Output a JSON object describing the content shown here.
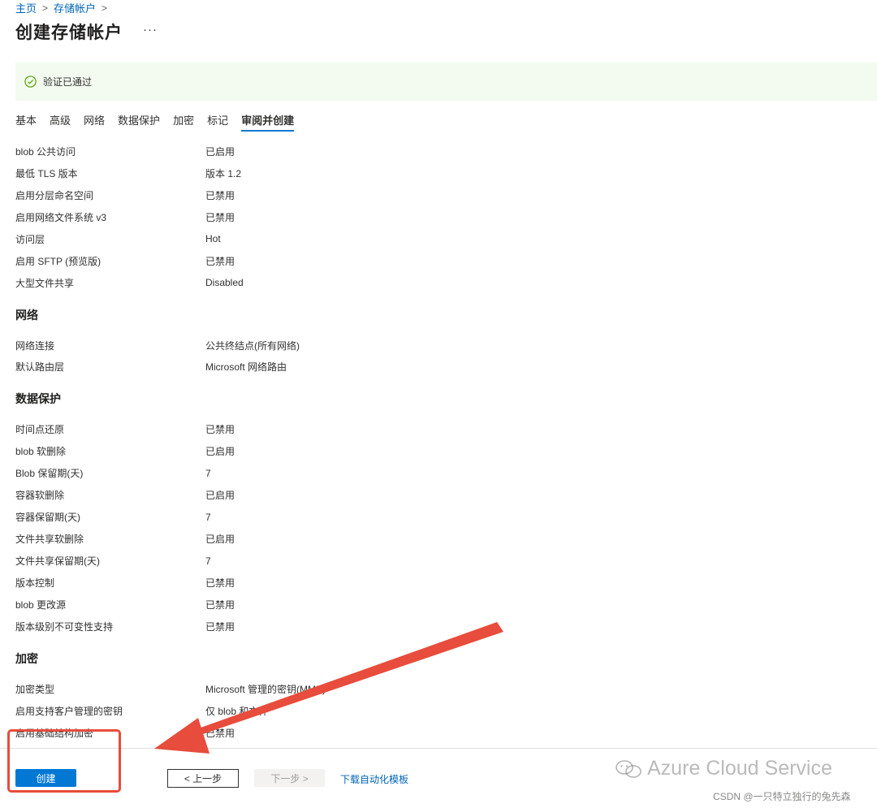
{
  "breadcrumb": {
    "home": "主页",
    "storage": "存储帐户",
    "sep": ">"
  },
  "page": {
    "title": "创建存储帐户",
    "more": "···"
  },
  "banner": {
    "message": "验证已通过"
  },
  "tabs": [
    {
      "label": "基本",
      "active": false
    },
    {
      "label": "高级",
      "active": false
    },
    {
      "label": "网络",
      "active": false
    },
    {
      "label": "数据保护",
      "active": false
    },
    {
      "label": "加密",
      "active": false
    },
    {
      "label": "标记",
      "active": false
    },
    {
      "label": "审阅并创建",
      "active": true
    }
  ],
  "advanced_rows": [
    {
      "key": "blob 公共访问",
      "value": "已启用"
    },
    {
      "key": "最低 TLS 版本",
      "value": "版本 1.2"
    },
    {
      "key": "启用分层命名空间",
      "value": "已禁用"
    },
    {
      "key": "启用网络文件系统 v3",
      "value": "已禁用"
    },
    {
      "key": "访问层",
      "value": "Hot"
    },
    {
      "key": "启用 SFTP (预览版)",
      "value": "已禁用"
    },
    {
      "key": "大型文件共享",
      "value": "Disabled"
    }
  ],
  "network": {
    "heading": "网络",
    "rows": [
      {
        "key": "网络连接",
        "value": "公共终结点(所有网络)"
      },
      {
        "key": "默认路由层",
        "value": "Microsoft 网络路由"
      }
    ]
  },
  "data_protection": {
    "heading": "数据保护",
    "rows": [
      {
        "key": "时间点还原",
        "value": "已禁用"
      },
      {
        "key": "blob 软删除",
        "value": "已启用"
      },
      {
        "key": "Blob 保留期(天)",
        "value": "7"
      },
      {
        "key": "容器软删除",
        "value": "已启用"
      },
      {
        "key": "容器保留期(天)",
        "value": "7"
      },
      {
        "key": "文件共享软删除",
        "value": "已启用"
      },
      {
        "key": "文件共享保留期(天)",
        "value": "7"
      },
      {
        "key": "版本控制",
        "value": "已禁用"
      },
      {
        "key": "blob 更改源",
        "value": "已禁用"
      },
      {
        "key": "版本级别不可变性支持",
        "value": "已禁用"
      }
    ]
  },
  "encryption": {
    "heading": "加密",
    "rows": [
      {
        "key": "加密类型",
        "value": "Microsoft 管理的密钥(MMK)"
      },
      {
        "key": "启用支持客户管理的密钥",
        "value": "仅 blob 和文件"
      },
      {
        "key": "启用基础结构加密",
        "value": "已禁用"
      }
    ]
  },
  "footer": {
    "create": "创建",
    "prev": "< 上一步",
    "next": "下一步 >",
    "template_link": "下载自动化模板"
  },
  "watermark": {
    "brand": "Azure Cloud Service",
    "credit": "CSDN @一只特立独行的兔先森"
  },
  "colors": {
    "accent": "#0078d4",
    "link": "#0066b8",
    "success": "#57a300",
    "annotation": "#e74c3c"
  }
}
